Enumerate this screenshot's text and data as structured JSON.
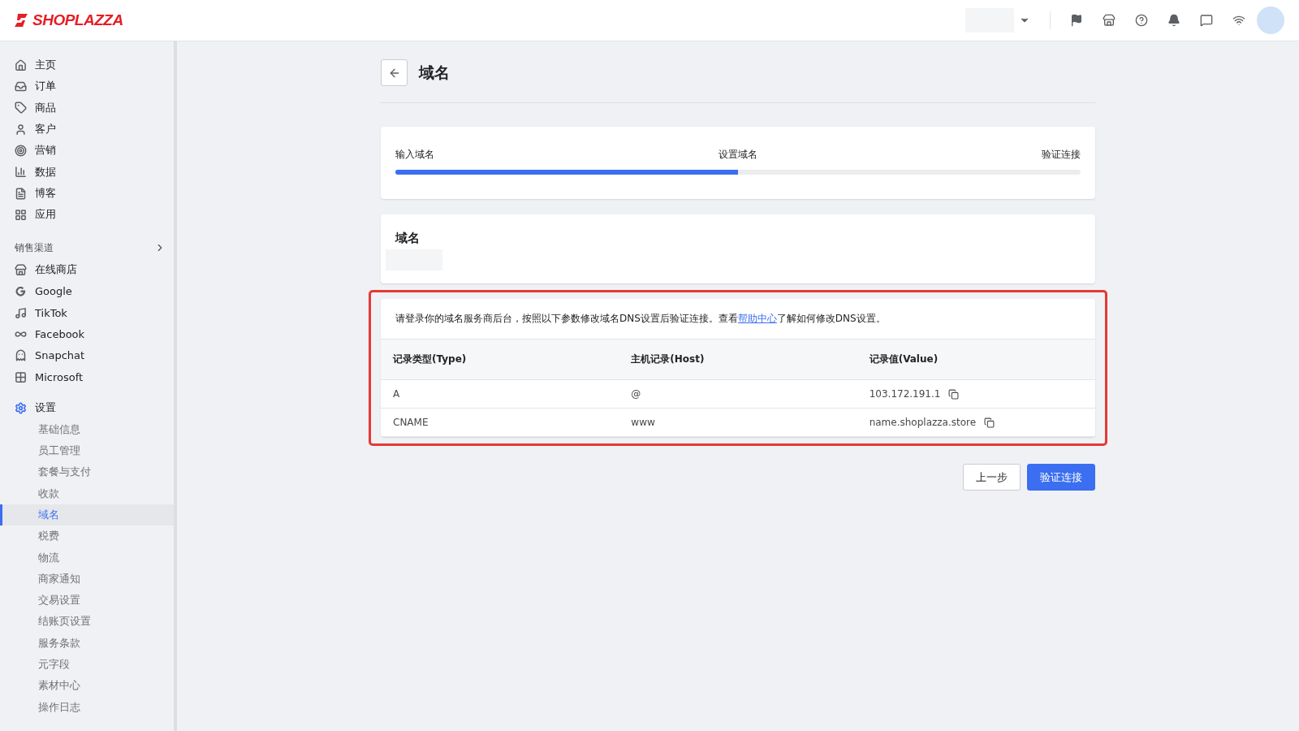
{
  "logo": {
    "text": "SHOPLAZZA"
  },
  "sidebar": {
    "main_items": [
      {
        "label": "主页"
      },
      {
        "label": "订单"
      },
      {
        "label": "商品"
      },
      {
        "label": "客户"
      },
      {
        "label": "营销"
      },
      {
        "label": "数据"
      },
      {
        "label": "博客"
      },
      {
        "label": "应用"
      }
    ],
    "channels_heading": "销售渠道",
    "channels": [
      {
        "label": "在线商店"
      },
      {
        "label": "Google"
      },
      {
        "label": "TikTok"
      },
      {
        "label": "Facebook"
      },
      {
        "label": "Snapchat"
      },
      {
        "label": "Microsoft"
      }
    ],
    "settings": {
      "label": "设置",
      "children": [
        {
          "label": "基础信息",
          "selected": false
        },
        {
          "label": "员工管理",
          "selected": false
        },
        {
          "label": "套餐与支付",
          "selected": false
        },
        {
          "label": "收款",
          "selected": false
        },
        {
          "label": "域名",
          "selected": true
        },
        {
          "label": "税费",
          "selected": false
        },
        {
          "label": "物流",
          "selected": false
        },
        {
          "label": "商家通知",
          "selected": false
        },
        {
          "label": "交易设置",
          "selected": false
        },
        {
          "label": "结账页设置",
          "selected": false
        },
        {
          "label": "服务条款",
          "selected": false
        },
        {
          "label": "元字段",
          "selected": false
        },
        {
          "label": "素材中心",
          "selected": false
        },
        {
          "label": "操作日志",
          "selected": false
        }
      ]
    }
  },
  "page": {
    "title": "域名"
  },
  "progress": {
    "steps": [
      "输入域名",
      "设置域名",
      "验证连接"
    ],
    "level": 0.5
  },
  "domain_card": {
    "title": "域名"
  },
  "instructions": {
    "text_before": "请登录你的域名服务商后台，按照以下参数修改域名DNS设置后验证连接。查看",
    "link": "帮助中心",
    "text_after": "了解如何修改DNS设置。"
  },
  "table": {
    "columns": [
      "记录类型(Type)",
      "主机记录(Host)",
      "记录值(Value)"
    ],
    "rows": [
      [
        "A",
        "@",
        "103.172.191.1"
      ],
      [
        "CNAME",
        "www",
        "name.shoplazza.store"
      ]
    ]
  },
  "buttons": [
    {
      "label": "上一步",
      "kind": "secondary"
    },
    {
      "label": "验证连接",
      "kind": "primary"
    }
  ]
}
